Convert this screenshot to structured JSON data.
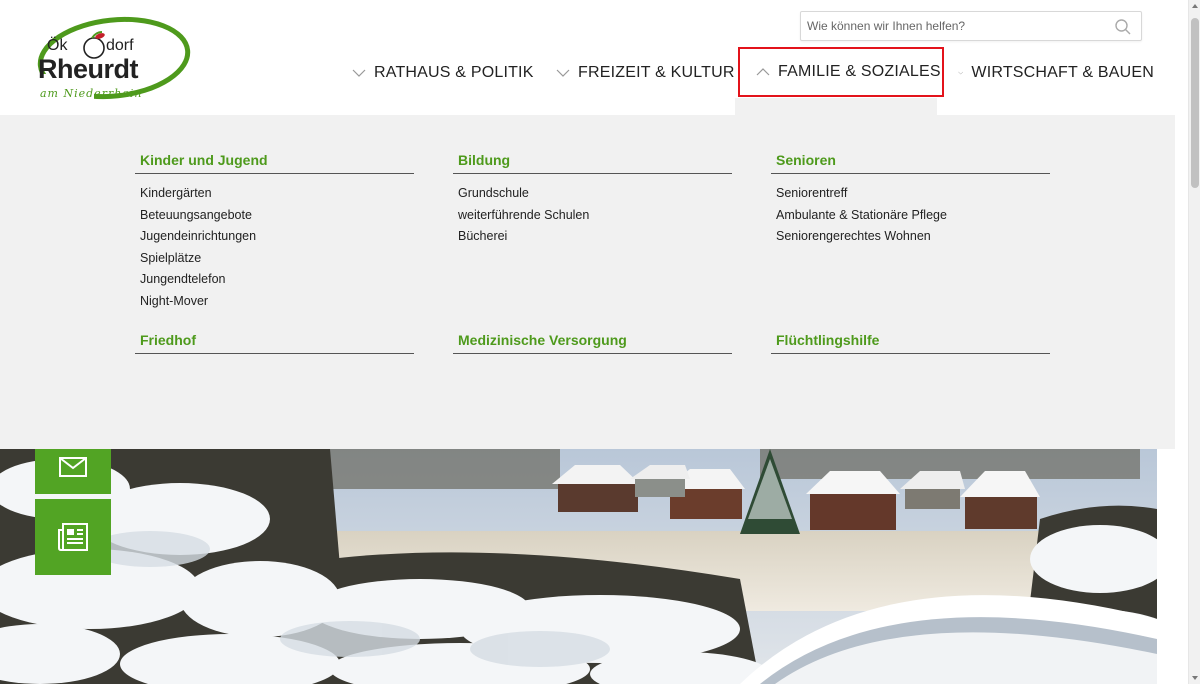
{
  "search": {
    "placeholder": "Wie können wir Ihnen helfen?"
  },
  "logo": {
    "line1": "Ök",
    "line1b": "dorf",
    "name": "Rheurdt",
    "tagline": "am Niederrhein"
  },
  "nav": [
    {
      "label": "RATHAUS & POLITIK",
      "chevron": "chevron-down-icon"
    },
    {
      "label": "FREIZEIT & KULTUR",
      "chevron": "chevron-down-icon"
    },
    {
      "label": "FAMILIE & SOZIALES",
      "chevron": "chevron-up-icon"
    },
    {
      "label": "WIRTSCHAFT & BAUEN",
      "chevron": "chevron-down-icon"
    }
  ],
  "mega": {
    "columns": [
      {
        "heading": "Kinder und Jugend",
        "items": [
          "Kindergärten",
          "Beteuungsangebote",
          "Jugendeinrichtungen",
          "Spielplätze",
          "Jungendtelefon",
          "Night-Mover"
        ]
      },
      {
        "heading": "Bildung",
        "items": [
          "Grundschule",
          "weiterführende Schulen",
          "Bücherei"
        ]
      },
      {
        "heading": "Senioren",
        "items": [
          "Seniorentreff",
          "Ambulante & Stationäre Pflege",
          "Seniorengerechtes Wohnen"
        ]
      },
      {
        "heading": "Friedhof",
        "items": []
      },
      {
        "heading": "Medizinische Versorgung",
        "items": []
      },
      {
        "heading": "Flüchtlingshilfe",
        "items": []
      }
    ]
  },
  "side_buttons": [
    {
      "icon": "mail-icon"
    },
    {
      "icon": "newspaper-icon"
    }
  ],
  "colors": {
    "brand_green": "#4e9a1c",
    "button_green": "#52a424",
    "highlight_red": "#e3131b",
    "dropdown_bg": "#f1f1f1"
  }
}
